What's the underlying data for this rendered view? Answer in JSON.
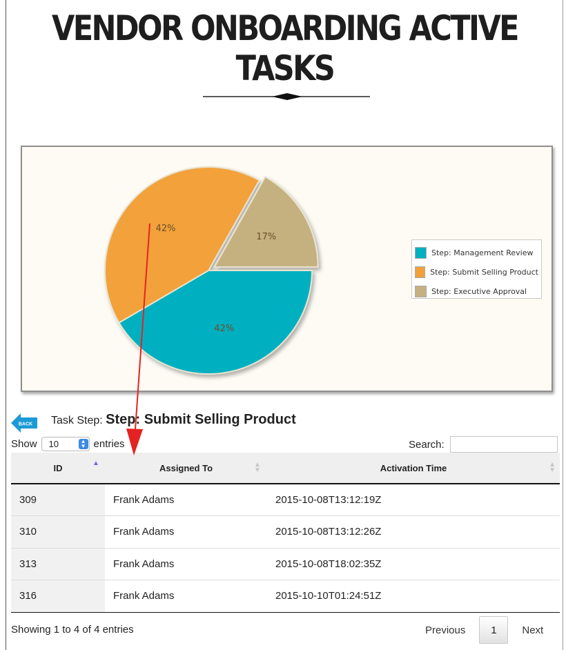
{
  "page": {
    "title": "VENDOR ONBOARDING ACTIVE TASKS"
  },
  "chart_data": {
    "type": "pie",
    "slices": [
      {
        "name": "Step: Management Review",
        "value": 42,
        "label": "42%",
        "color": "#00b0c0"
      },
      {
        "name": "Step: Submit Selling Product",
        "value": 42,
        "label": "42%",
        "color": "#f2a13a"
      },
      {
        "name": "Step: Executive Approval",
        "value": 17,
        "label": "17%",
        "color": "#c5b180"
      }
    ],
    "legend_position": "right",
    "background": "#fdfbf3"
  },
  "task_panel": {
    "back_label": "BACK",
    "task_step_prefix": "Task Step:",
    "task_step_name": "Step: Submit Selling Product"
  },
  "table_controls": {
    "show_label": "Show",
    "entries_value": "10",
    "entries_label": "entries",
    "search_label": "Search:",
    "search_value": ""
  },
  "table": {
    "columns": [
      "ID",
      "Assigned To",
      "Activation Time"
    ],
    "rows": [
      {
        "id": "309",
        "assigned_to": "Frank Adams",
        "activation_time": "2015-10-08T13:12:19Z"
      },
      {
        "id": "310",
        "assigned_to": "Frank Adams",
        "activation_time": "2015-10-08T13:12:26Z"
      },
      {
        "id": "313",
        "assigned_to": "Frank Adams",
        "activation_time": "2015-10-08T18:02:35Z"
      },
      {
        "id": "316",
        "assigned_to": "Frank Adams",
        "activation_time": "2015-10-10T01:24:51Z"
      }
    ]
  },
  "footer": {
    "info": "Showing 1 to 4 of 4 entries",
    "previous": "Previous",
    "current_page": "1",
    "next": "Next"
  },
  "colors": {
    "accent_blue": "#1a9ad6",
    "annotation_arrow": "#e52222"
  },
  "icons": {
    "back": "back-arrow-icon",
    "sort_asc": "sort-ascending-icon",
    "sort_both": "sort-both-icon",
    "select_arrows": "updown-chevron-icon"
  }
}
